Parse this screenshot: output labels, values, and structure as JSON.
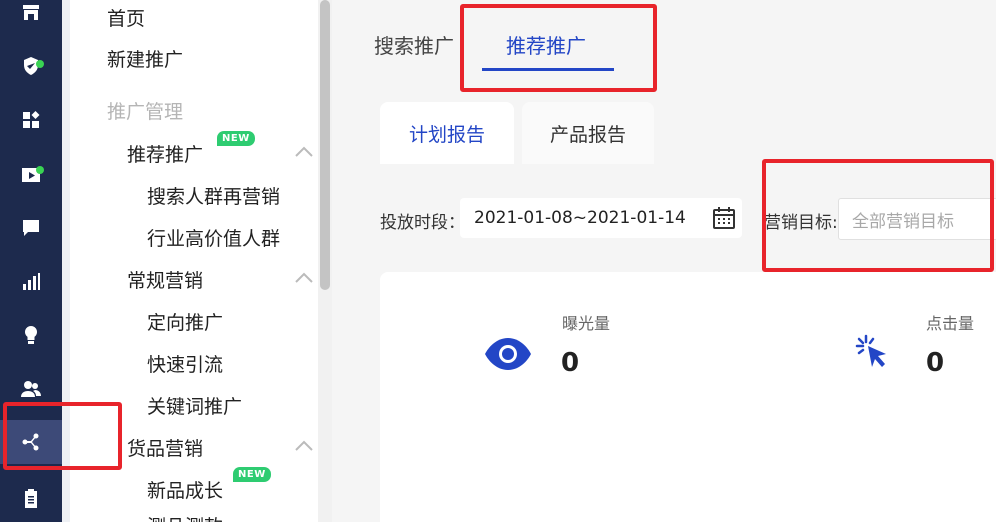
{
  "colors": {
    "rail_bg": "#1d2a4d",
    "rail_active": "#3d4a78",
    "accent": "#2346c6",
    "badge_green": "#2ecc71",
    "highlight_red": "#e8242b"
  },
  "rail": {
    "icons": [
      "store-icon",
      "shield-check-icon",
      "widgets-icon",
      "video-icon",
      "chat-icon",
      "bar-chart-icon",
      "lightbulb-icon",
      "users-icon",
      "share-flow-icon",
      "clipboard-icon"
    ],
    "active": "share-flow-icon"
  },
  "sidebar": {
    "home": "首页",
    "new_promotion": "新建推广",
    "promotion_management": "推广管理",
    "recommend": {
      "label": "推荐推广",
      "badge": "NEW",
      "children": [
        "搜索人群再营销",
        "行业高价值人群"
      ]
    },
    "regular": {
      "label": "常规营销",
      "children": [
        "定向推广",
        "快速引流",
        "关键词推广"
      ]
    },
    "goods": {
      "label": "货品营销",
      "children": [
        "新品成长"
      ],
      "child_badge": "NEW",
      "partial_next": "测品测款"
    }
  },
  "main": {
    "top_tabs": [
      "搜索推广",
      "推荐推广"
    ],
    "active_top_tab": "推荐推广",
    "sub_tabs": [
      "计划报告",
      "产品报告"
    ],
    "active_sub_tab": "计划报告",
    "filters": {
      "period_label": "投放时段：",
      "period_value": "2021-01-08~2021-01-14",
      "goal_label": "营销目标:",
      "goal_placeholder": "全部营销目标"
    },
    "metrics": [
      {
        "label": "曝光量",
        "value": "0",
        "icon": "eye-icon"
      },
      {
        "label": "点击量",
        "value": "0",
        "icon": "click-cursor-icon"
      }
    ]
  }
}
